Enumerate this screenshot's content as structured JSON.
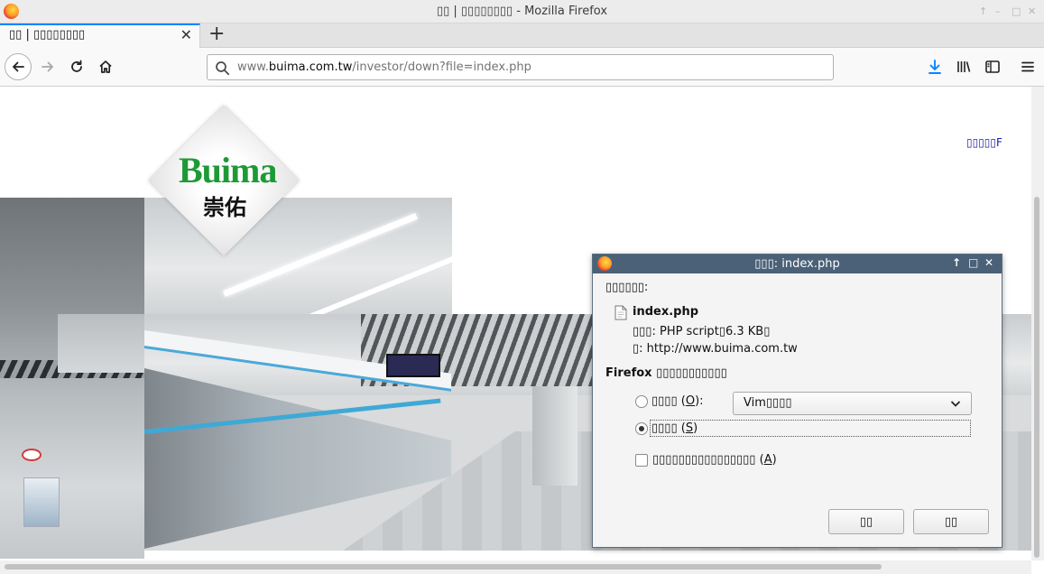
{
  "window": {
    "title": "▯▯ | ▯▯▯▯▯▯▯▯ - Mozilla Firefox",
    "controls": [
      "↑",
      "–",
      "□",
      "✕"
    ]
  },
  "tab": {
    "label": "▯▯ | ▯▯▯▯▯▯▯▯",
    "close": "✕"
  },
  "newtab": "+",
  "urlbar": {
    "url_prefix": "www.",
    "url_domain": "buima.com.tw",
    "url_path": "/investor/down?file=index.php"
  },
  "page": {
    "logo_text": "Buima",
    "logo_chinese": "崇佑",
    "corner_link": "▯▯▯▯▯F"
  },
  "dialog": {
    "title": "▯▯▯: index.php",
    "controls": [
      "↑",
      "□",
      "✕"
    ],
    "opening_label": "▯▯▯▯▯▯:",
    "file_name": "index.php",
    "file_type": "▯▯▯: PHP script▯6.3 KB▯",
    "file_from": "▯: http://www.buima.com.tw",
    "question": "Firefox ▯▯▯▯▯▯▯▯▯▯▯",
    "open_with_label": "▯▯▯▯",
    "open_with_key": "O",
    "open_with_app": "Vim▯▯▯▯",
    "save_label": "▯▯▯▯",
    "save_key": "S",
    "remember_label": "▯▯▯▯▯▯▯▯▯▯▯▯▯▯▯▯",
    "remember_key": "A",
    "ok_button": "▯▯",
    "cancel_button": "▯▯"
  }
}
